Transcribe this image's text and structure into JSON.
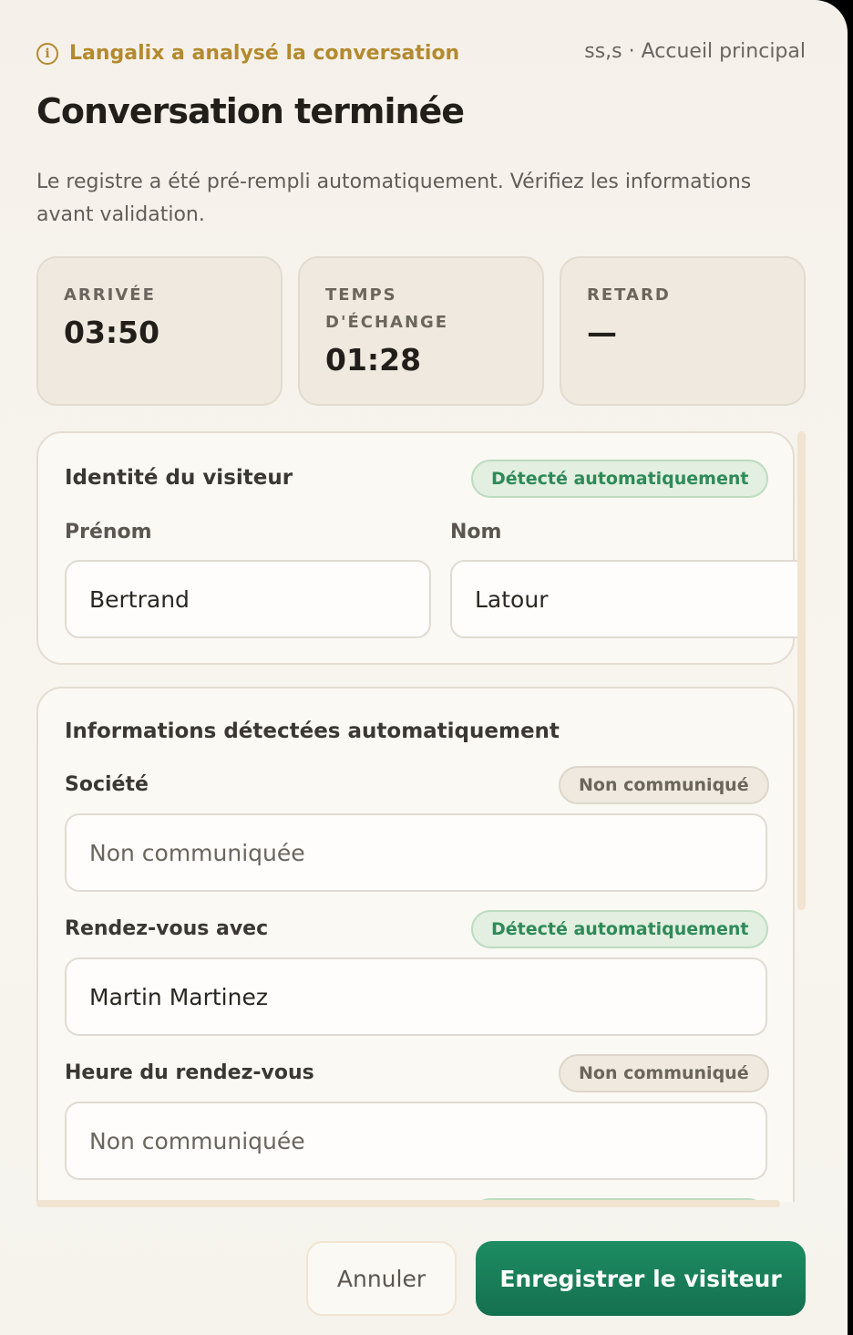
{
  "header": {
    "analysis_text": "Langalix a analysé la conversation",
    "location": "ss,s · Accueil principal",
    "title": "Conversation terminée",
    "subtitle": "Le registre a été pré-rempli automatiquement. Vérifiez les informations avant validation."
  },
  "stats": [
    {
      "label": "ARRIVÉE",
      "value": "03:50"
    },
    {
      "label": "TEMPS D'ÉCHANGE",
      "value": "01:28"
    },
    {
      "label": "RETARD",
      "value": "—"
    }
  ],
  "identity": {
    "title": "Identité du visiteur",
    "badge": "Détecté automatiquement",
    "first_name_label": "Prénom",
    "first_name_value": "Bertrand",
    "last_name_label": "Nom",
    "last_name_value": "Latour"
  },
  "info": {
    "title": "Informations détectées automatiquement",
    "company_label": "Société",
    "company_badge": "Non communiqué",
    "company_placeholder": "Non communiquée",
    "appointment_with_label": "Rendez-vous avec",
    "appointment_with_badge": "Détecté automatiquement",
    "appointment_with_value": "Martin Martinez",
    "appointment_time_label": "Heure du rendez-vous",
    "appointment_time_badge": "Non communiqué",
    "appointment_time_placeholder": "Non communiquée"
  },
  "actions": {
    "cancel": "Annuler",
    "save": "Enregistrer le visiteur"
  },
  "colors": {
    "accent_gold": "#b48a2e",
    "primary_green": "#1a7f5a",
    "badge_green": "#2e8a57"
  },
  "icons": {
    "analysis": "info-icon"
  }
}
